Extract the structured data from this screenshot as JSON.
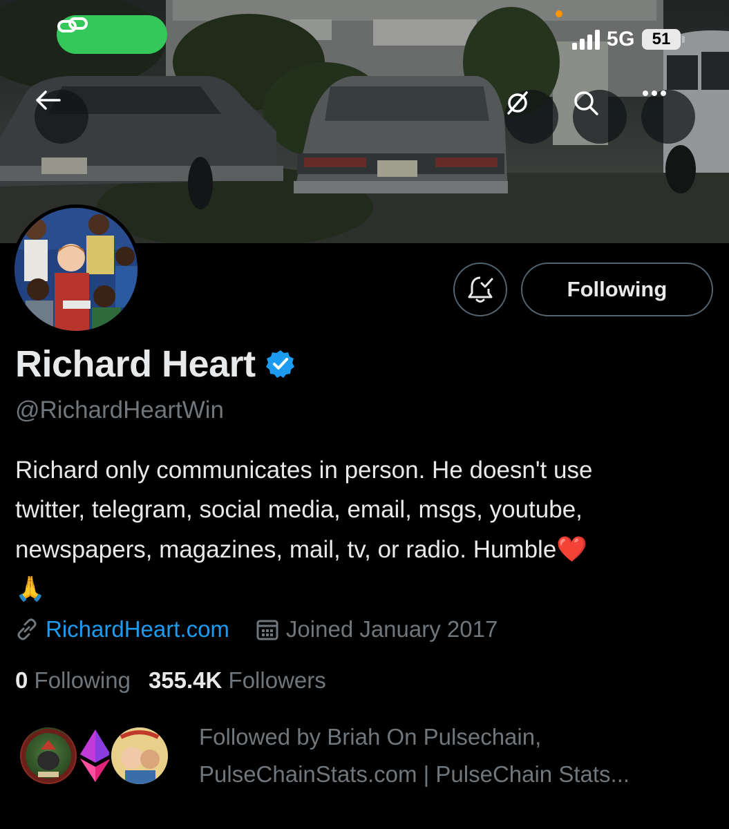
{
  "status_bar": {
    "network": "5G",
    "battery": "51",
    "link_icon": "link-icon"
  },
  "header": {
    "back_icon": "back-arrow-icon",
    "grok_icon": "grok-icon",
    "search_icon": "search-icon",
    "more_icon": "more-icon"
  },
  "profile": {
    "name": "Richard Heart",
    "verified": true,
    "handle": "@RichardHeartWin",
    "bio_lines": [
      "Richard only communicates in person. He doesn't use",
      "twitter, telegram, social media, email, msgs, youtube,",
      "newspapers, magazines, mail, tv, or radio. Humble"
    ],
    "bio_heart": "❤️",
    "bio_pray": "🙏",
    "website": "RichardHeart.com",
    "joined": "Joined January 2017",
    "following_count": "0",
    "following_label": "Following",
    "followers_count": "355.4K",
    "followers_label": "Followers",
    "followed_by_line1": "Followed by Briah On Pulsechain,",
    "followed_by_line2": "PulseChainStats.com | PulseChain Stats..."
  },
  "actions": {
    "follow_label": "Following",
    "notify_icon": "bell-check-icon"
  },
  "colors": {
    "background": "#000000",
    "text_primary": "#e7e9ea",
    "text_secondary": "#71767b",
    "link": "#1d9bf0",
    "verified": "#1d9bf0",
    "pill": "#34c759"
  }
}
